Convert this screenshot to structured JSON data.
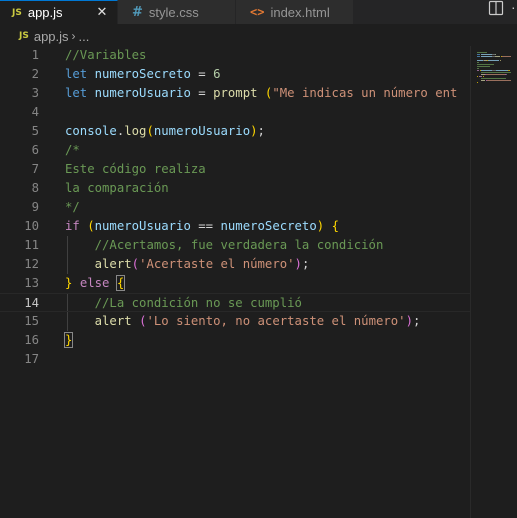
{
  "tabs": [
    {
      "icon": "JS",
      "label": "app.js",
      "close": "✕",
      "active": true
    },
    {
      "icon": "#",
      "label": "style.css",
      "active": false
    },
    {
      "icon": "<>",
      "label": "index.html",
      "active": false
    }
  ],
  "breadcrumb": {
    "icon": "JS",
    "file": "app.js",
    "separator": "›",
    "rest": "..."
  },
  "editor": {
    "current_line": 14,
    "lines": [
      {
        "n": "1",
        "tokens": [
          {
            "t": "//Variables",
            "c": "cm"
          }
        ]
      },
      {
        "n": "2",
        "tokens": [
          {
            "t": "let",
            "c": "kw"
          },
          {
            "t": " "
          },
          {
            "t": "numeroSecreto",
            "c": "var"
          },
          {
            "t": " = "
          },
          {
            "t": "6",
            "c": "num"
          }
        ]
      },
      {
        "n": "3",
        "tokens": [
          {
            "t": "let",
            "c": "kw"
          },
          {
            "t": " "
          },
          {
            "t": "numeroUsuario",
            "c": "var"
          },
          {
            "t": " = "
          },
          {
            "t": "prompt",
            "c": "fn"
          },
          {
            "t": " "
          },
          {
            "t": "(",
            "c": "p1"
          },
          {
            "t": "\"Me indicas un número ent",
            "c": "str"
          }
        ]
      },
      {
        "n": "4",
        "tokens": []
      },
      {
        "n": "5",
        "tokens": [
          {
            "t": "console",
            "c": "var"
          },
          {
            "t": "."
          },
          {
            "t": "log",
            "c": "fn"
          },
          {
            "t": "(",
            "c": "p1"
          },
          {
            "t": "numeroUsuario",
            "c": "var"
          },
          {
            "t": ")",
            "c": "p1"
          },
          {
            "t": ";"
          }
        ]
      },
      {
        "n": "6",
        "tokens": [
          {
            "t": "/*",
            "c": "cm"
          }
        ]
      },
      {
        "n": "7",
        "tokens": [
          {
            "t": "Este código realiza",
            "c": "cm"
          }
        ]
      },
      {
        "n": "8",
        "tokens": [
          {
            "t": "la comparación",
            "c": "cm"
          }
        ]
      },
      {
        "n": "9",
        "tokens": [
          {
            "t": "*/",
            "c": "cm"
          }
        ]
      },
      {
        "n": "10",
        "tokens": [
          {
            "t": "if",
            "c": "ctl"
          },
          {
            "t": " "
          },
          {
            "t": "(",
            "c": "p1"
          },
          {
            "t": "numeroUsuario",
            "c": "var"
          },
          {
            "t": " == "
          },
          {
            "t": "numeroSecreto",
            "c": "var"
          },
          {
            "t": ")",
            "c": "p1"
          },
          {
            "t": " "
          },
          {
            "t": "{",
            "c": "p1"
          }
        ]
      },
      {
        "n": "11",
        "tokens": [
          {
            "t": "    "
          },
          {
            "t": "//Acertamos, fue verdadera la condición",
            "c": "cm"
          }
        ]
      },
      {
        "n": "12",
        "tokens": [
          {
            "t": "    "
          },
          {
            "t": "alert",
            "c": "fn"
          },
          {
            "t": "(",
            "c": "p2"
          },
          {
            "t": "'Acertaste el número'",
            "c": "str"
          },
          {
            "t": ")",
            "c": "p2"
          },
          {
            "t": ";"
          }
        ]
      },
      {
        "n": "13",
        "tokens": [
          {
            "t": "}",
            "c": "p1"
          },
          {
            "t": " "
          },
          {
            "t": "else",
            "c": "ctl"
          },
          {
            "t": " "
          },
          {
            "t": "{",
            "c": "p1 bm"
          }
        ]
      },
      {
        "n": "14",
        "tokens": [
          {
            "t": "    "
          },
          {
            "t": "//La condición no se cumplió",
            "c": "cm"
          }
        ]
      },
      {
        "n": "15",
        "tokens": [
          {
            "t": "    "
          },
          {
            "t": "alert",
            "c": "fn"
          },
          {
            "t": " "
          },
          {
            "t": "(",
            "c": "p2"
          },
          {
            "t": "'Lo siento, no acertaste el número'",
            "c": "str"
          },
          {
            "t": ")",
            "c": "p2"
          },
          {
            "t": ";"
          }
        ]
      },
      {
        "n": "16",
        "tokens": [
          {
            "t": "}",
            "c": "p1 bm"
          }
        ]
      },
      {
        "n": "17",
        "tokens": []
      }
    ]
  },
  "colors": {
    "comment": "#6a9955",
    "keyword": "#569cd6",
    "control": "#c586c0",
    "variable": "#9cdcfe",
    "number": "#b5cea8",
    "function": "#dcdcaa",
    "string": "#ce9178",
    "bracket_1": "#ffd700",
    "bracket_2": "#da70d6",
    "background": "#1e1e1e",
    "accent": "#0078d4"
  },
  "icons": {
    "split_editor": "split-editor-icon",
    "more_actions": "more-actions-icon"
  }
}
